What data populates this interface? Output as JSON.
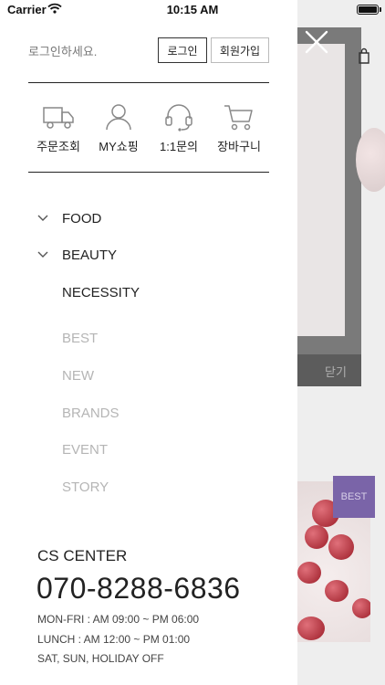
{
  "status_bar": {
    "carrier": "Carrier",
    "time": "10:15 AM"
  },
  "background": {
    "close_label": "닫기",
    "badge": "BEST"
  },
  "drawer": {
    "login_prompt": "로그인하세요.",
    "login_button": "로그인",
    "join_button": "회원가입",
    "quick_links": [
      {
        "label": "주문조회",
        "icon": "truck-icon"
      },
      {
        "label": "MY쇼핑",
        "icon": "user-icon"
      },
      {
        "label": "1:1문의",
        "icon": "headset-icon"
      },
      {
        "label": "장바구니",
        "icon": "cart-icon"
      }
    ],
    "categories": [
      {
        "label": "FOOD",
        "expandable": true
      },
      {
        "label": "BEAUTY",
        "expandable": true
      },
      {
        "label": "NECESSITY",
        "expandable": false
      }
    ],
    "sub_menu": [
      "BEST",
      "NEW",
      "BRANDS",
      "EVENT",
      "STORY"
    ],
    "cs": {
      "title": "CS CENTER",
      "phone": "070-8288-6836",
      "hours": [
        "MON-FRI : AM 09:00 ~ PM 06:00",
        "LUNCH : AM 12:00 ~ PM 01:00",
        "SAT, SUN, HOLIDAY OFF"
      ]
    }
  },
  "colors": {
    "accent_purple": "#7a64a8",
    "dim_backdrop": "#eeeeee",
    "muted_text": "#b5b5b5"
  }
}
